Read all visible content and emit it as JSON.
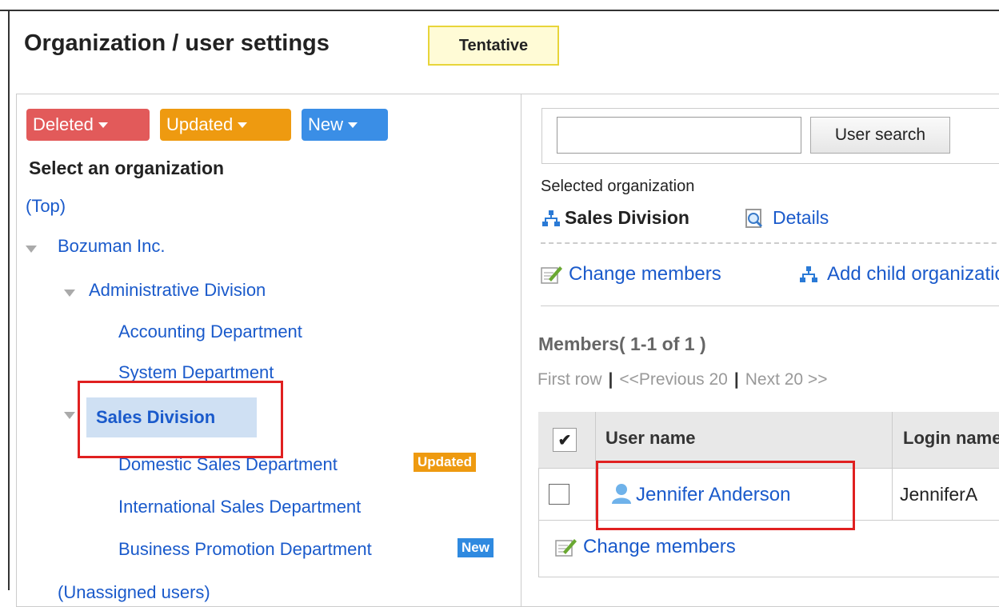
{
  "header": {
    "title": "Organization / user settings",
    "status_badge": "Tentative"
  },
  "filters": {
    "deleted": "Deleted",
    "updated": "Updated",
    "new": "New"
  },
  "tree": {
    "heading": "Select an organization",
    "top": "(Top)",
    "company": "Bozuman Inc.",
    "admin": "Administrative Division",
    "accounting": "Accounting Department",
    "system": "System Department",
    "sales": "Sales Division",
    "domestic": "Domestic Sales Department",
    "international": "International Sales Department",
    "business": "Business Promotion Department",
    "unassigned": "(Unassigned users)",
    "badge_updated": "Updated",
    "badge_new": "New"
  },
  "search": {
    "value": "",
    "button": "User search"
  },
  "selected": {
    "label": "Selected organization",
    "name": "Sales Division",
    "details": "Details",
    "change_members": "Change members",
    "add_child": "Add child organization"
  },
  "members": {
    "heading": "Members( 1-1 of 1 )",
    "pager": {
      "first": "First row",
      "prev": "<<Previous 20",
      "next": "Next 20 >>"
    },
    "columns": {
      "check": "✔",
      "user": "User name",
      "login": "Login name"
    },
    "rows": [
      {
        "user": "Jennifer Anderson",
        "login": "JenniferA"
      }
    ],
    "change_members": "Change members"
  }
}
